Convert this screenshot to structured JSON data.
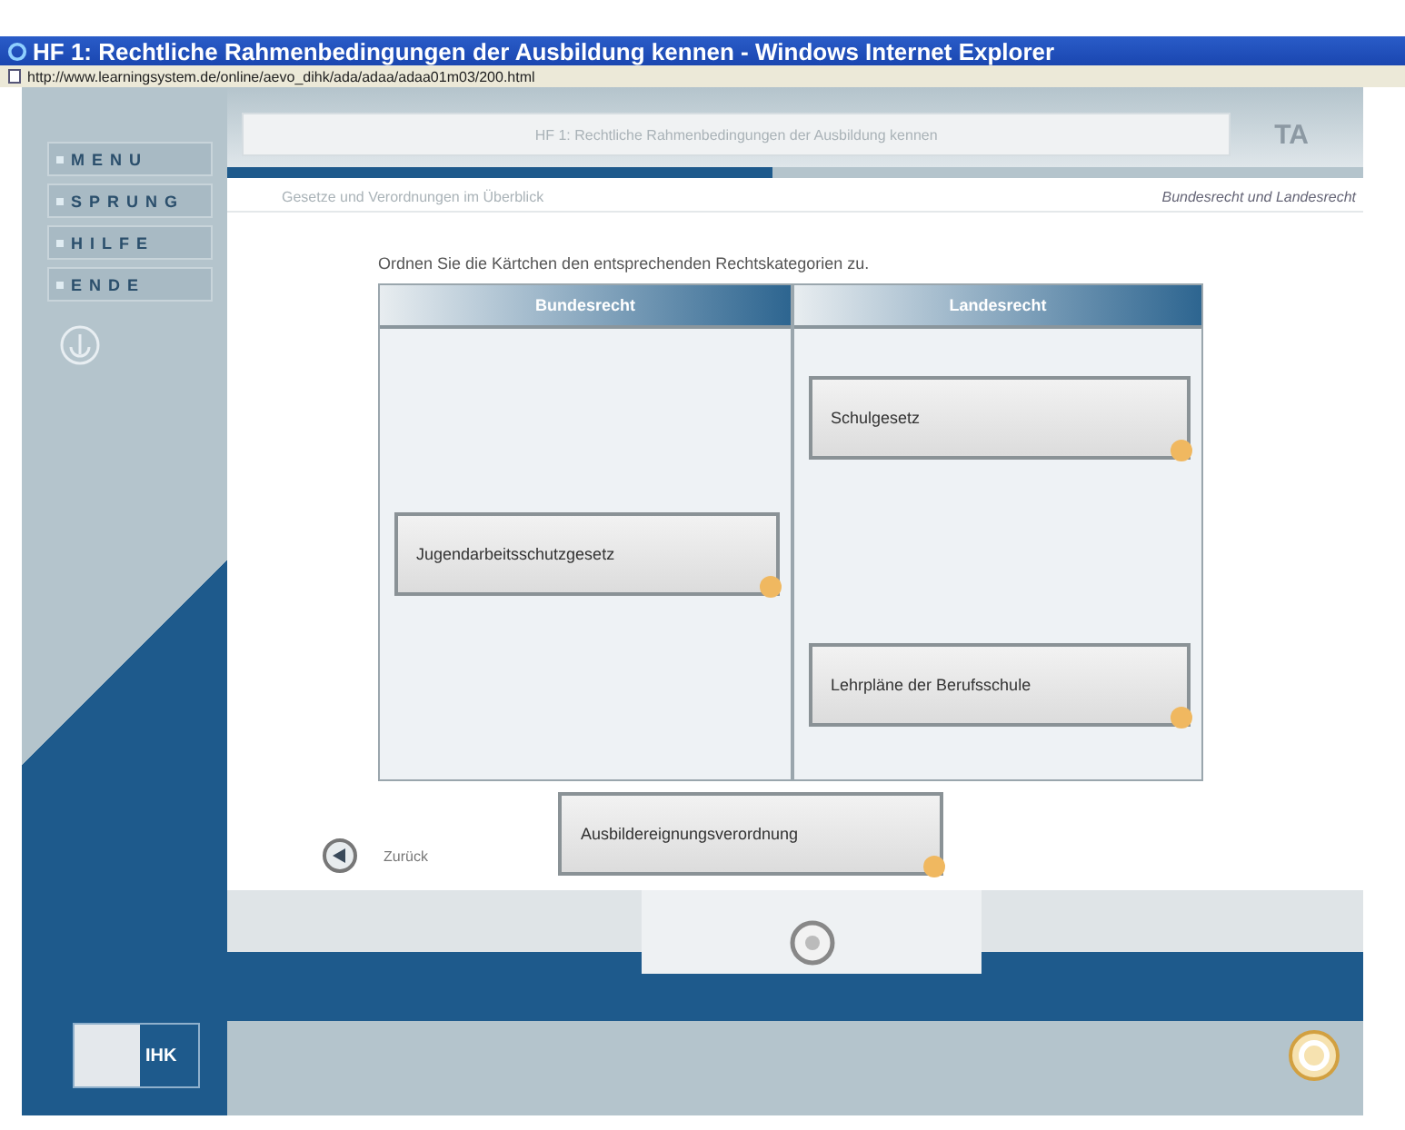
{
  "window": {
    "title": "HF 1: Rechtliche Rahmenbedingungen der Ausbildung kennen - Windows Internet Explorer",
    "address": "http://www.learningsystem.de/online/aevo_dihk/ada/adaa/adaa01m03/200.html"
  },
  "menu": [
    {
      "label": "MENU"
    },
    {
      "label": "SPRUNG"
    },
    {
      "label": "HILFE"
    },
    {
      "label": "ENDE"
    }
  ],
  "header": {
    "title": "HF 1: Rechtliche Rahmenbedingungen der Ausbildung kennen",
    "badge": "TA"
  },
  "subheader": {
    "left": "Gesetze und Verordnungen im Überblick",
    "right": "Bundesrecht und Landesrecht"
  },
  "instruction": "Ordnen Sie die Kärtchen den entsprechenden Rechtskategorien zu.",
  "columns": [
    {
      "title": "Bundesrecht",
      "cards": [
        "Jugendarbeitsschutzgesetz"
      ]
    },
    {
      "title": "Landesrecht",
      "cards": [
        "Schulgesetz",
        "Lehrpläne der Berufsschule"
      ]
    }
  ],
  "back": {
    "label": "Zurück"
  },
  "loose_card": "Ausbildereignungsverordnung",
  "logo": "IHK"
}
